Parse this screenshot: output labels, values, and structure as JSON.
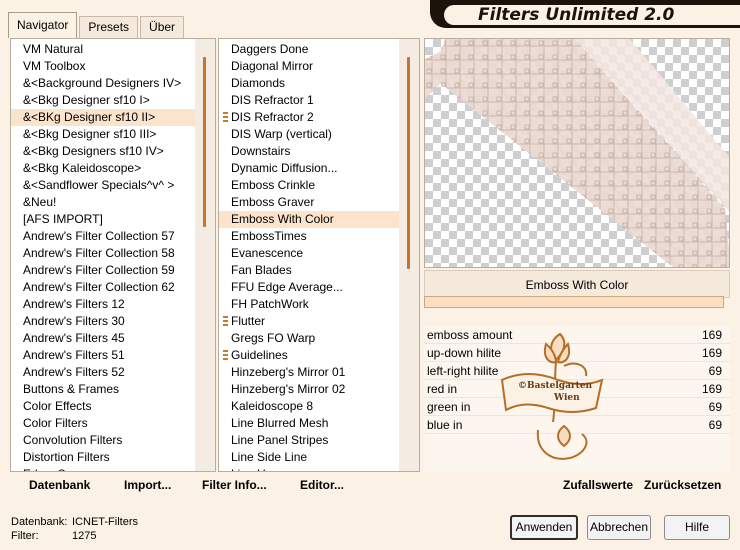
{
  "app": {
    "title": "Filters Unlimited 2.0"
  },
  "tabs": [
    {
      "label": "Navigator",
      "active": true
    },
    {
      "label": "Presets",
      "active": false
    },
    {
      "label": "Über",
      "active": false
    }
  ],
  "categories": [
    "VM Natural",
    "VM Toolbox",
    "&<Background Designers IV>",
    "&<Bkg Designer sf10 I>",
    "&<BKg Designer sf10 II>",
    "&<Bkg Designer sf10 III>",
    "&<Bkg Designers sf10 IV>",
    "&<Bkg Kaleidoscope>",
    "&<Sandflower Specials^v^ >",
    "&Neu!",
    "[AFS IMPORT]",
    "Andrew's Filter Collection 57",
    "Andrew's Filter Collection 58",
    "Andrew's Filter Collection 59",
    "Andrew's Filter Collection 62",
    "Andrew's Filters 12",
    "Andrew's Filters 30",
    "Andrew's Filters 45",
    "Andrew's Filters 51",
    "Andrew's Filters 52",
    "Buttons & Frames",
    "Color Effects",
    "Color Filters",
    "Convolution Filters",
    "Distortion Filters",
    "Edge, Square"
  ],
  "selected_category": "&<BKg Designer sf10 II>",
  "filters": [
    {
      "label": "Daggers Done",
      "marked": false
    },
    {
      "label": "Diagonal Mirror",
      "marked": false
    },
    {
      "label": "Diamonds",
      "marked": false
    },
    {
      "label": "DIS Refractor 1",
      "marked": false
    },
    {
      "label": "DIS Refractor 2",
      "marked": true
    },
    {
      "label": "DIS Warp (vertical)",
      "marked": false
    },
    {
      "label": "Downstairs",
      "marked": false
    },
    {
      "label": "Dynamic Diffusion...",
      "marked": false
    },
    {
      "label": "Emboss Crinkle",
      "marked": false
    },
    {
      "label": "Emboss Graver",
      "marked": false
    },
    {
      "label": "Emboss With Color",
      "marked": false
    },
    {
      "label": "EmbossTimes",
      "marked": false
    },
    {
      "label": "Evanescence",
      "marked": false
    },
    {
      "label": "Fan Blades",
      "marked": false
    },
    {
      "label": "FFU Edge Average...",
      "marked": false
    },
    {
      "label": "FH PatchWork",
      "marked": false
    },
    {
      "label": "Flutter",
      "marked": true
    },
    {
      "label": "Gregs FO Warp",
      "marked": false
    },
    {
      "label": "Guidelines",
      "marked": true
    },
    {
      "label": "Hinzeberg's Mirror 01",
      "marked": false
    },
    {
      "label": "Hinzeberg's Mirror 02",
      "marked": false
    },
    {
      "label": "Kaleidoscope 8",
      "marked": false
    },
    {
      "label": "Line Blurred Mesh",
      "marked": false
    },
    {
      "label": "Line Panel Stripes",
      "marked": false
    },
    {
      "label": "Line Side Line",
      "marked": false
    },
    {
      "label": "Line Ups",
      "marked": false
    }
  ],
  "selected_filter": "Emboss With Color",
  "preview": {
    "filter_name": "Emboss With Color",
    "progress": 1.0
  },
  "parameters": [
    {
      "label": "emboss amount",
      "value": "169"
    },
    {
      "label": "up-down hilite",
      "value": "169"
    },
    {
      "label": "left-right hilite",
      "value": "69"
    },
    {
      "label": "red in",
      "value": "169"
    },
    {
      "label": "green in",
      "value": "69"
    },
    {
      "label": "blue in",
      "value": "69"
    }
  ],
  "logo": {
    "text_line1": "©Bastelgarten",
    "text_line2": "Wien"
  },
  "bottom_links": {
    "database": "Datenbank",
    "import": "Import...",
    "filter_info": "Filter Info...",
    "editor": "Editor...",
    "random": "Zufallswerte",
    "reset": "Zurücksetzen"
  },
  "footer": {
    "database_label": "Datenbank:",
    "database_value": "ICNET-Filters",
    "filter_label": "Filter:",
    "filter_value": "1275"
  },
  "buttons": {
    "apply": "Anwenden",
    "cancel": "Abbrechen",
    "help": "Hilfe"
  },
  "colors": {
    "accent": "#c5742c",
    "title_bg": "#1c140c",
    "window_bg": "#fbf1e4"
  }
}
